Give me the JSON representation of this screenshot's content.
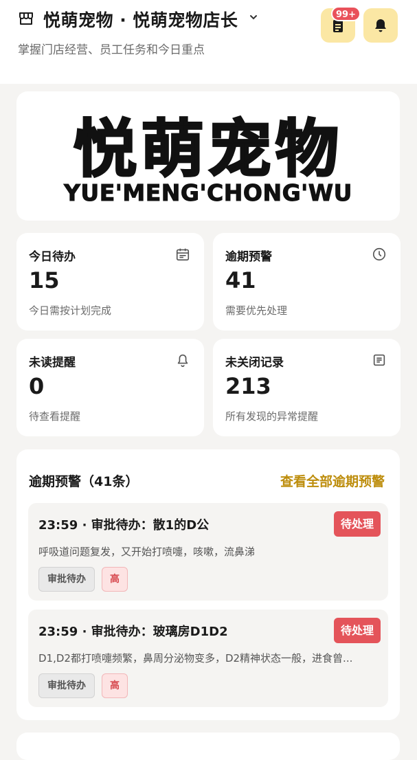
{
  "header": {
    "title": "悦萌宠物 · 悦萌宠物店长",
    "subtitle": "掌握门店经营、员工任务和今日重点",
    "badge": "99+",
    "icons": {
      "store": "store-icon",
      "dropdown": "chevron-down-icon",
      "tasks": "clipboard-icon",
      "notify": "bell-icon"
    },
    "accent": "#fbe7a4"
  },
  "brand": {
    "name_cn": "悦萌宠物",
    "name_en": "YUE'MENG'CHONG'WU"
  },
  "stats": [
    {
      "label": "今日待办",
      "value": "15",
      "desc": "今日需按计划完成",
      "icon": "calendar-icon"
    },
    {
      "label": "逾期预警",
      "value": "41",
      "desc": "需要优先处理",
      "icon": "clock-icon"
    },
    {
      "label": "未读提醒",
      "value": "0",
      "desc": "待查看提醒",
      "icon": "bell-icon"
    },
    {
      "label": "未关闭记录",
      "value": "213",
      "desc": "所有发现的异常提醒",
      "icon": "document-icon"
    }
  ],
  "overdue": {
    "title": "逾期预警（41条）",
    "link": "查看全部逾期预警",
    "link_color": "#bd8d0c",
    "items": [
      {
        "title": "23:59 · 审批待办：散1的D公",
        "status": "待处理",
        "desc": "呼吸道问题复发，又开始打喷嚏，咳嗽，流鼻涕",
        "tag_type": "审批待办",
        "tag_priority": "高"
      },
      {
        "title": "23:59 · 审批待办：玻璃房D1D2",
        "status": "待处理",
        "desc": "D1,D2都打喷嚏频繁，鼻周分泌物变多，D2精神状态一般，进食曾...",
        "tag_type": "审批待办",
        "tag_priority": "高"
      }
    ]
  }
}
